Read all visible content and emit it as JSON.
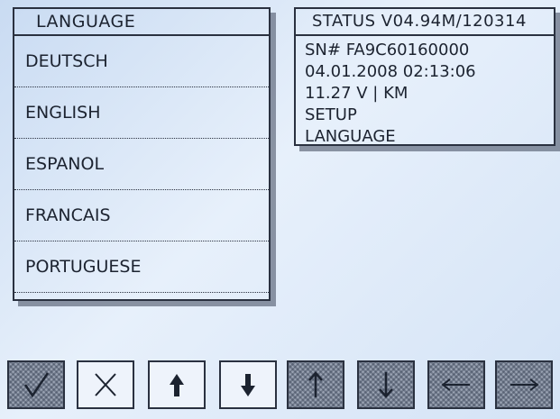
{
  "language_panel": {
    "title": "LANGUAGE",
    "items": [
      {
        "label": "DEUTSCH"
      },
      {
        "label": "ENGLISH"
      },
      {
        "label": "ESPANOL"
      },
      {
        "label": "FRANCAIS"
      },
      {
        "label": "PORTUGUESE"
      }
    ]
  },
  "status_panel": {
    "title": "STATUS V04.94M/120314",
    "lines": [
      "SN# FA9C60160000",
      "04.01.2008  02:13:06",
      "11.27 V | KM",
      "SETUP",
      "LANGUAGE"
    ]
  },
  "buttons": [
    {
      "name": "confirm-button",
      "icon": "check-icon",
      "style": "dark"
    },
    {
      "name": "cancel-button",
      "icon": "x-icon",
      "style": "light"
    },
    {
      "name": "page-up-button",
      "icon": "bold-arrow-up-icon",
      "style": "light"
    },
    {
      "name": "page-down-button",
      "icon": "bold-arrow-down-icon",
      "style": "light"
    },
    {
      "name": "up-button",
      "icon": "arrow-up-icon",
      "style": "dark"
    },
    {
      "name": "down-button",
      "icon": "arrow-down-icon",
      "style": "dark"
    },
    {
      "name": "left-button",
      "icon": "arrow-left-icon",
      "style": "dark"
    },
    {
      "name": "right-button",
      "icon": "arrow-right-icon",
      "style": "dark"
    }
  ]
}
